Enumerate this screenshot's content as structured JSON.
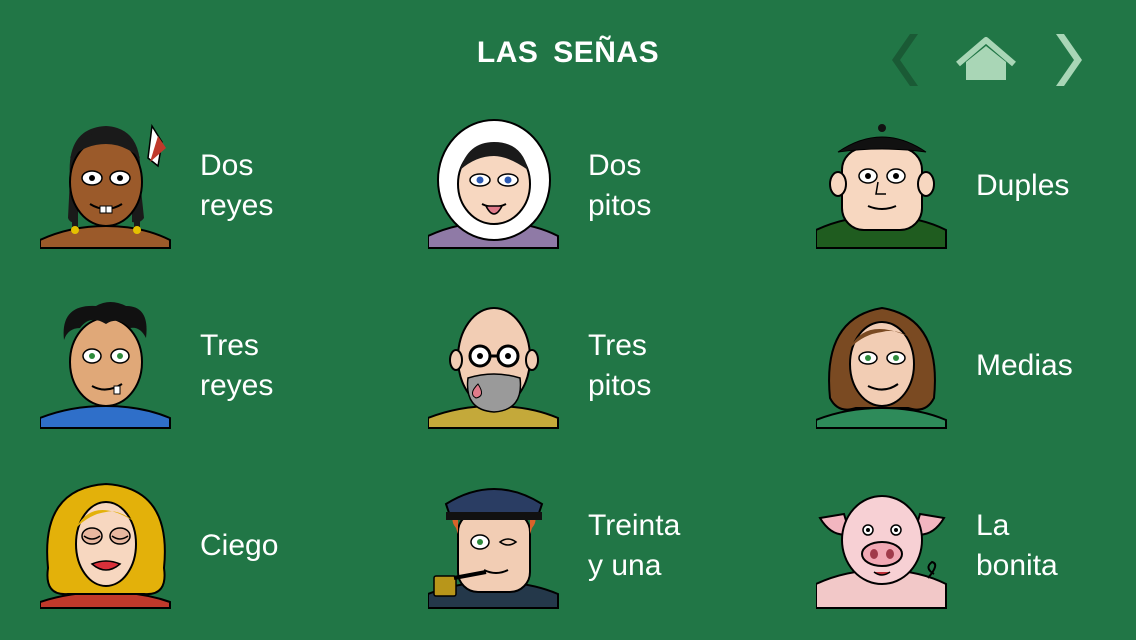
{
  "header": {
    "title": "LAS  SEÑAS",
    "back_icon": "chevron-left-icon",
    "home_icon": "home-icon",
    "forward_icon": "chevron-right-icon"
  },
  "grid": [
    {
      "label": "Dos\nreyes",
      "avatar": "native-man-feather"
    },
    {
      "label": "Dos\npitos",
      "avatar": "eskimo-hood"
    },
    {
      "label": "Duples",
      "avatar": "beret-man"
    },
    {
      "label": "Tres\nreyes",
      "avatar": "curly-hair-man"
    },
    {
      "label": "Tres\npitos",
      "avatar": "bald-glasses-man"
    },
    {
      "label": "Medias",
      "avatar": "brown-hair-woman"
    },
    {
      "label": "Ciego",
      "avatar": "blonde-woman-eyes-closed"
    },
    {
      "label": "Treinta\ny una",
      "avatar": "sailor-winking-pipe"
    },
    {
      "label": "La\nbonita",
      "avatar": "pig"
    }
  ],
  "colors": {
    "background": "#217646",
    "nav_icon": "#a8d8b8",
    "nav_icon_dim": "#1e5a36"
  }
}
